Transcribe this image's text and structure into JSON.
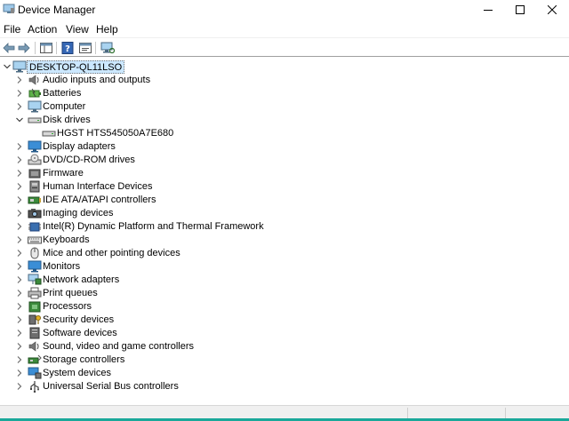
{
  "window": {
    "title": "Device Manager"
  },
  "menu": [
    "File",
    "Action",
    "View",
    "Help"
  ],
  "toolbar": {
    "buttons": [
      "back-icon",
      "forward-icon",
      "show-hide-console-tree-icon",
      "help-icon",
      "properties-icon",
      "scan-hardware-icon"
    ]
  },
  "tree": {
    "root": "DESKTOP-QL11LSO",
    "categories": [
      {
        "label": "Audio inputs and outputs",
        "icon": "speaker-icon",
        "expanded": false
      },
      {
        "label": "Batteries",
        "icon": "battery-icon",
        "expanded": false
      },
      {
        "label": "Computer",
        "icon": "computer-icon",
        "expanded": false
      },
      {
        "label": "Disk drives",
        "icon": "disk-drive-icon",
        "expanded": true,
        "children": [
          "HGST HTS545050A7E680"
        ]
      },
      {
        "label": "Display adapters",
        "icon": "display-adapter-icon",
        "expanded": false
      },
      {
        "label": "DVD/CD-ROM drives",
        "icon": "dvd-drive-icon",
        "expanded": false
      },
      {
        "label": "Firmware",
        "icon": "firmware-icon",
        "expanded": false
      },
      {
        "label": "Human Interface Devices",
        "icon": "hid-icon",
        "expanded": false
      },
      {
        "label": "IDE ATA/ATAPI controllers",
        "icon": "ide-controller-icon",
        "expanded": false
      },
      {
        "label": "Imaging devices",
        "icon": "camera-icon",
        "expanded": false
      },
      {
        "label": "Intel(R) Dynamic Platform and Thermal Framework",
        "icon": "chip-icon",
        "expanded": false
      },
      {
        "label": "Keyboards",
        "icon": "keyboard-icon",
        "expanded": false
      },
      {
        "label": "Mice and other pointing devices",
        "icon": "mouse-icon",
        "expanded": false
      },
      {
        "label": "Monitors",
        "icon": "monitor-icon",
        "expanded": false
      },
      {
        "label": "Network adapters",
        "icon": "network-adapter-icon",
        "expanded": false
      },
      {
        "label": "Print queues",
        "icon": "printer-icon",
        "expanded": false
      },
      {
        "label": "Processors",
        "icon": "processor-icon",
        "expanded": false
      },
      {
        "label": "Security devices",
        "icon": "security-key-icon",
        "expanded": false
      },
      {
        "label": "Software devices",
        "icon": "software-device-icon",
        "expanded": false
      },
      {
        "label": "Sound, video and game controllers",
        "icon": "sound-icon",
        "expanded": false
      },
      {
        "label": "Storage controllers",
        "icon": "storage-controller-icon",
        "expanded": false
      },
      {
        "label": "System devices",
        "icon": "system-device-icon",
        "expanded": false
      },
      {
        "label": "Universal Serial Bus controllers",
        "icon": "usb-icon",
        "expanded": false
      }
    ]
  },
  "colors": {
    "selection": "#cce8ff",
    "accent": "#1aa89a"
  }
}
